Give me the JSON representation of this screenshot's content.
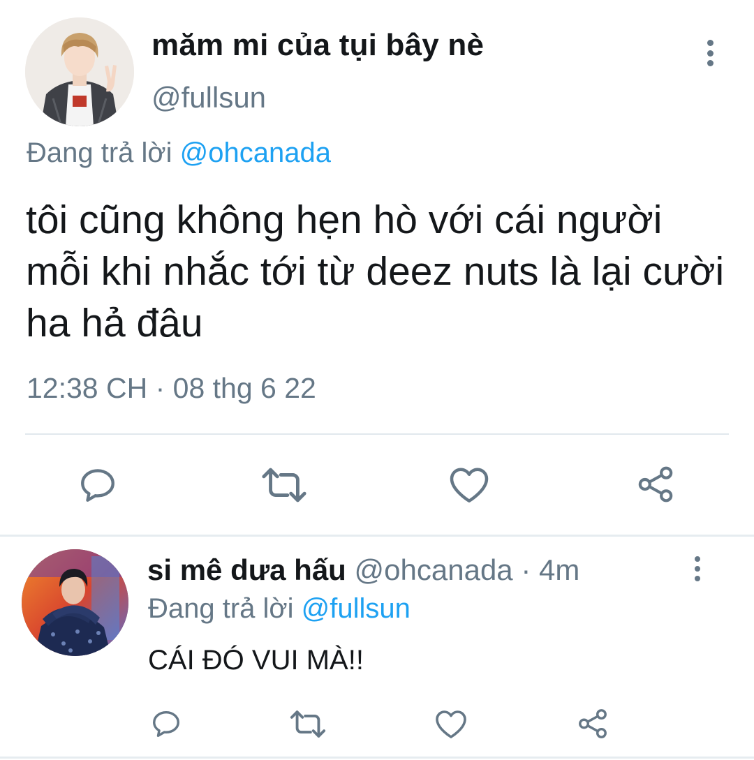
{
  "main_tweet": {
    "display_name": "măm mi của tụi bây nè",
    "handle": "@fullsun",
    "replying_prefix": "Đang trả lời",
    "replying_to": "@ohcanada",
    "text": "tôi cũng không hẹn hò với cái người mỗi khi nhắc tới từ deez nuts là lại cười ha hả đâu",
    "timestamp": "12:38 CH · 08 thg 6 22",
    "actions": [
      "reply-icon",
      "retweet-icon",
      "like-icon",
      "share-icon"
    ]
  },
  "reply_tweet": {
    "display_name": "si mê dưa hấu",
    "handle": "@ohcanada",
    "separator": " · ",
    "time": "4m",
    "replying_prefix": "Đang trả lời",
    "replying_to": "@fullsun",
    "text": "CÁI ĐÓ VUI MÀ!!",
    "actions": [
      "reply-icon",
      "retweet-icon",
      "like-icon",
      "share-icon"
    ]
  },
  "colors": {
    "text_primary": "#14171a",
    "text_secondary": "#657786",
    "link": "#1da1f2",
    "divider": "#e1e8ed"
  }
}
